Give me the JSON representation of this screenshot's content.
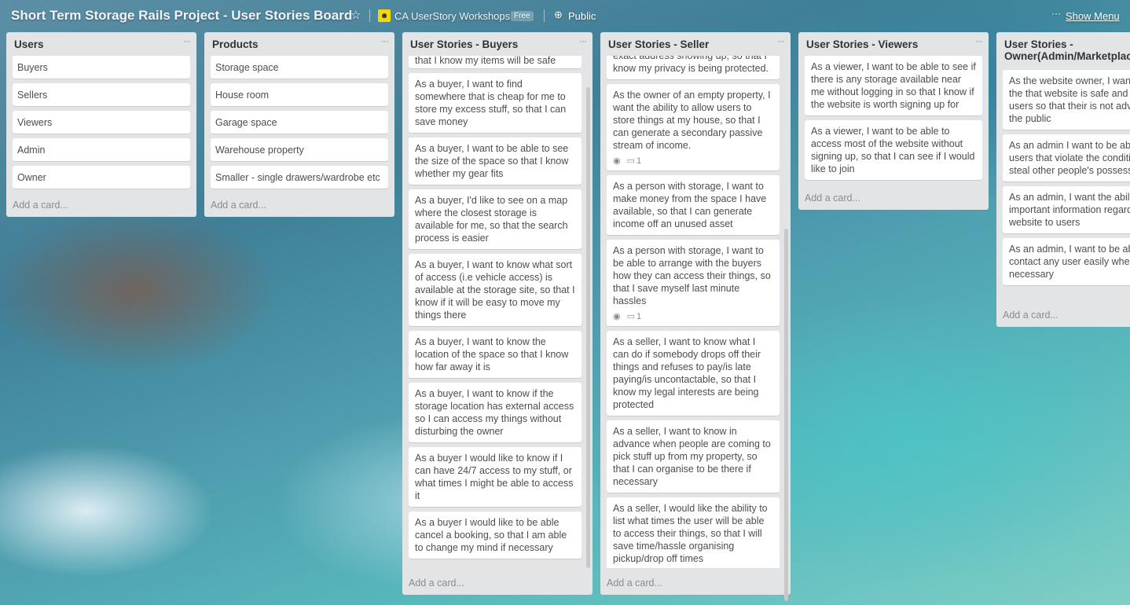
{
  "header": {
    "board_title": "Short Term Storage Rails Project - User Stories Board",
    "team_name": "CA UserStory Workshops",
    "plan_badge": "Free",
    "visibility": "Public",
    "menu_dots": "···",
    "show_menu": "Show Menu",
    "star_icon": "☆",
    "globe_icon": "⊕"
  },
  "add_card_label": "Add a card...",
  "lists": [
    {
      "title": "Users",
      "cards": [
        "Buyers",
        "Sellers",
        "Viewers",
        "Admin",
        "Owner"
      ]
    },
    {
      "title": "Products",
      "cards": [
        "Storage space",
        "House room",
        "Garage space",
        "Warehouse property",
        "Smaller - single drawers/wardrobe etc"
      ]
    },
    {
      "title": "User Stories - Buyers",
      "cards": [
        "that I know my items will be safe",
        "As a buyer, I want to find somewhere that is cheap for me to store my excess stuff, so that I can save money",
        "As a buyer, I want to be able to see the size of the space so that I know whether my gear fits",
        "As a buyer, I'd like to see on a map where the closest storage is available for me, so that the search process is easier",
        "As a buyer, I want to know what sort of access (i.e vehicle access) is available at the storage site, so that I know if it will be easy to move my things there",
        "As a buyer, I want to know the location of the space so that I know how far away it is",
        "As a buyer, I want to know if the storage location has external access so I can access my things without disturbing the owner",
        "As a buyer I would like to know if I can have 24/7 access to my stuff, or what times I might be able to access it",
        "As a buyer I would like to be able cancel a booking, so that I am able to change my mind if necessary"
      ]
    },
    {
      "title": "User Stories - Seller",
      "cards": [
        "exact address showing up, so that I know my privacy is being protected.",
        "As the owner of an empty property, I want the ability to allow users to store things at my house, so that I can generate a secondary passive stream of income.",
        "As a person with storage, I want to make money from the space I have available, so that I can generate income off an unused asset",
        "As a person with storage, I want to be able to arrange with the buyers how they can access their things, so that I save myself last minute hassles",
        "As a seller, I want to know what I can do if somebody drops off their things and refuses to pay/is late paying/is uncontactable, so that I know my legal interests are being protected",
        "As a seller, I want to know in advance when people are coming to pick stuff up from my property, so that I can organise to be there if necessary",
        "As a seller, I would like the ability to list what times the user will be able to access their things, so that I will save time/hassle organising pickup/drop off times"
      ],
      "badge_eye": "👁",
      "badge_comment_count": "1"
    },
    {
      "title": "User Stories - Viewers",
      "cards": [
        "As a viewer, I want to be able to see if there is any storage available near me without logging in so that I know if the website is worth signing up for",
        "As a viewer, I want to be able to access most of the website without signing up, so that I can see if I would like to join"
      ]
    },
    {
      "title": "User Stories - Owner(Admin/Marketplace",
      "cards": [
        "As the website owner, I want to ensure the that website is safe and secure for users so that their is not advertised to the public",
        "As an admin I want to be able to delete users that violate the conditions (i.e. steal other people's possessions)",
        "As an admin, I want the ability to important information regarding website to users",
        "As an admin, I want to be able to contact any user easily when necessary"
      ]
    }
  ]
}
